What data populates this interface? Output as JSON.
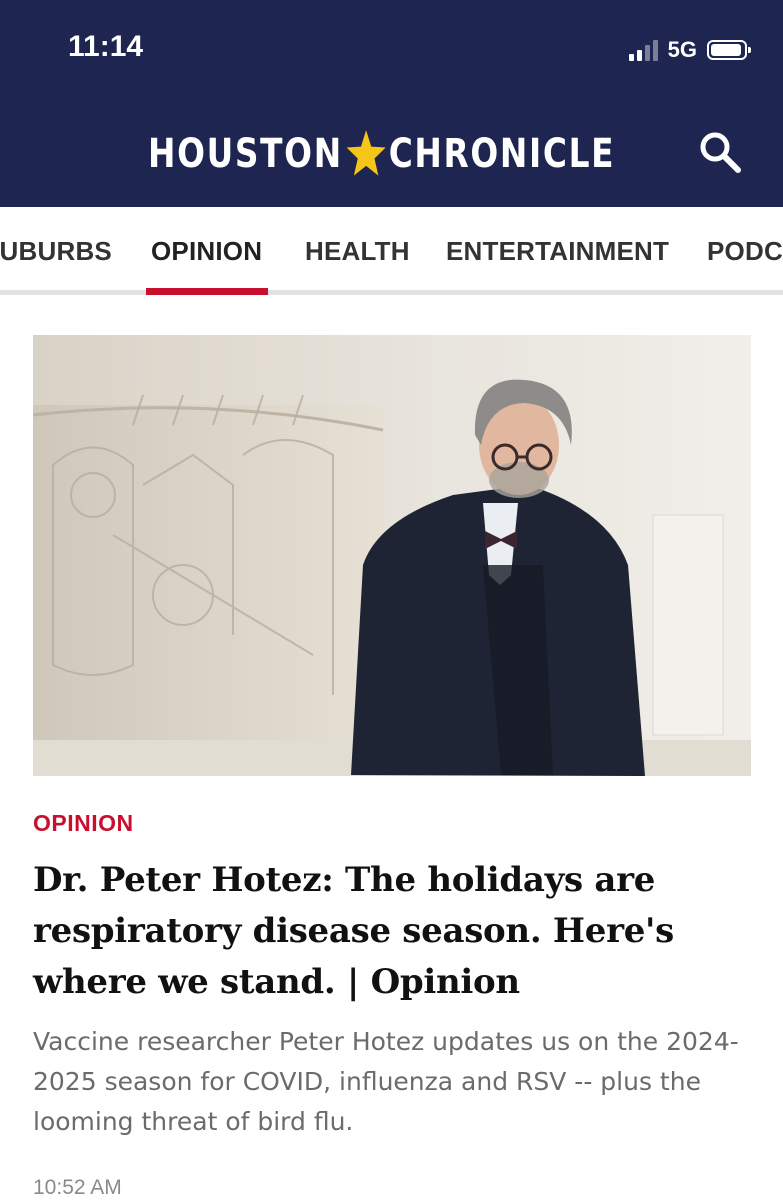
{
  "status_bar": {
    "time": "11:14",
    "network": "5G"
  },
  "header": {
    "logo_left": "HOUSTON",
    "logo_right": "CHRONICLE",
    "search_icon": "search-icon"
  },
  "nav": {
    "items": [
      {
        "label": "SUBURBS",
        "active": false
      },
      {
        "label": "OPINION",
        "active": true
      },
      {
        "label": "HEALTH",
        "active": false
      },
      {
        "label": "ENTERTAINMENT",
        "active": false
      },
      {
        "label": "PODCASTS",
        "active": false
      }
    ]
  },
  "article": {
    "kicker": "OPINION",
    "headline": "Dr. Peter Hotez: The holidays are respiratory disease season. Here's where we stand. | Opinion",
    "dek": "Vaccine researcher Peter Hotez updates us on the 2024-2025 season for COVID, influenza and RSV -- plus the looming threat of bird flu.",
    "timestamp": "10:52 AM"
  },
  "colors": {
    "header_bg": "#1d2550",
    "accent_red": "#c8102e",
    "star_gold": "#f5c518"
  }
}
